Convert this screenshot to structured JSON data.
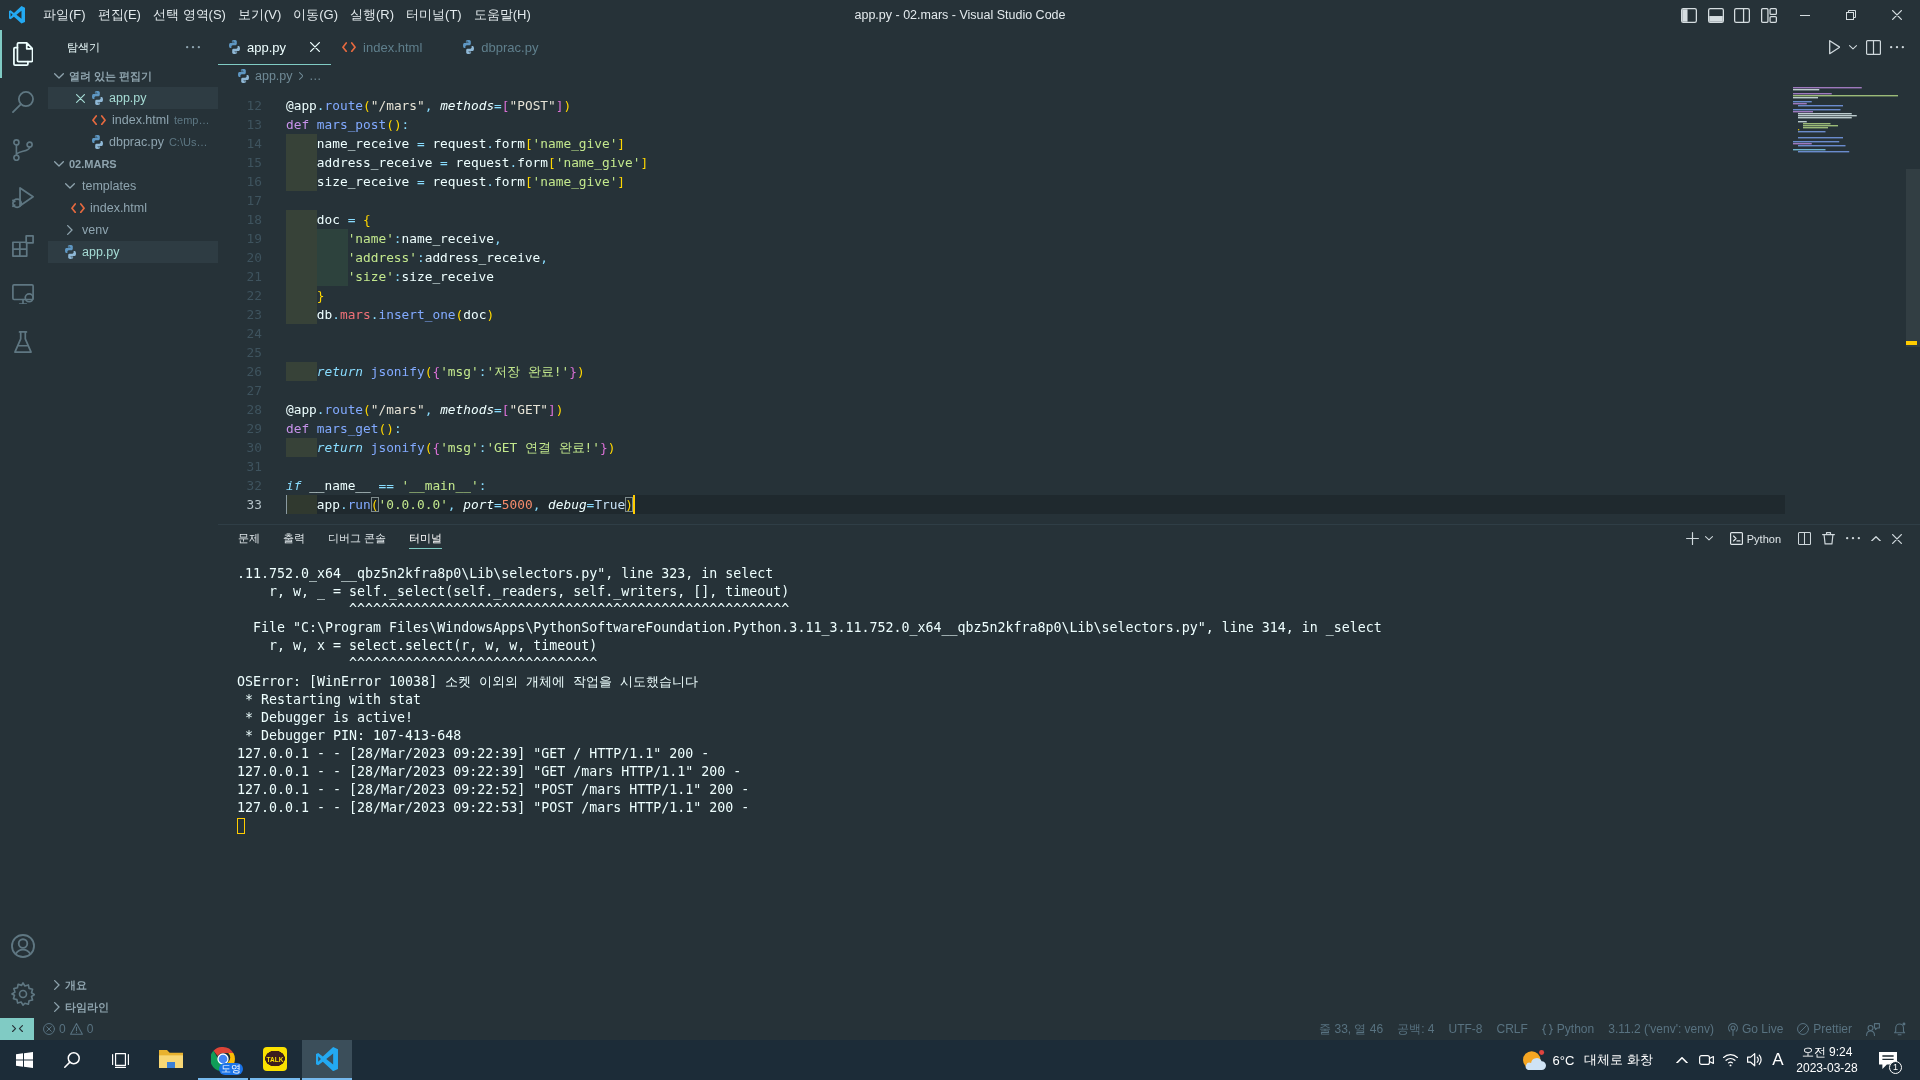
{
  "title_bar": {
    "menus": [
      "파일(F)",
      "편집(E)",
      "선택 영역(S)",
      "보기(V)",
      "이동(G)",
      "실행(R)",
      "터미널(T)",
      "도움말(H)"
    ],
    "title": "app.py - 02.mars - Visual Studio Code",
    "layout_toggles": [
      {
        "kind": "sidebar",
        "on": true
      },
      {
        "kind": "panel",
        "on": true
      },
      {
        "kind": "secondary",
        "on": false
      }
    ]
  },
  "activity_bar": {
    "items": [
      {
        "kind": "explorer",
        "selected": true
      },
      {
        "kind": "search",
        "selected": false
      },
      {
        "kind": "source_control",
        "selected": false
      },
      {
        "kind": "run_debug",
        "selected": false
      },
      {
        "kind": "extensions",
        "selected": false
      },
      {
        "kind": "remote",
        "selected": false
      },
      {
        "kind": "testing",
        "selected": false
      }
    ],
    "bottom": [
      {
        "kind": "account"
      },
      {
        "kind": "settings"
      }
    ]
  },
  "sidebar": {
    "title": "탐색기",
    "open_editors": {
      "label": "열려 있는 편집기",
      "expanded": true,
      "items": [
        {
          "kind": "python",
          "name": "app.py",
          "selected": true
        },
        {
          "kind": "html",
          "name": "index.html",
          "description": "temp…",
          "selected": false
        },
        {
          "kind": "python",
          "name": "dbprac.py",
          "description": "C:\\Us…",
          "selected": false
        }
      ]
    },
    "folder": {
      "label": "02.MARS",
      "expanded": true,
      "tree": [
        {
          "kind": "folder",
          "name": "templates",
          "expanded": true,
          "selected": false,
          "children": [
            {
              "kind": "html",
              "name": "index.html",
              "selected": false
            }
          ]
        },
        {
          "kind": "folder",
          "name": "venv",
          "expanded": false,
          "selected": false
        },
        {
          "kind": "python",
          "name": "app.py",
          "selected": true
        }
      ]
    },
    "bottom_sections": [
      {
        "label": "개요",
        "expanded": false
      },
      {
        "label": "타임라인",
        "expanded": false
      }
    ]
  },
  "editor": {
    "tabs": [
      {
        "kind": "python",
        "label": "app.py",
        "selected": true
      },
      {
        "kind": "html",
        "label": "index.html",
        "selected": false
      },
      {
        "kind": "python",
        "label": "dbprac.py",
        "selected": false
      }
    ],
    "breadcrumbs": [
      {
        "kind": "python",
        "label": "app.py"
      },
      {
        "kind": "symbol",
        "label": "…"
      }
    ],
    "lines": [
      {
        "number": "12",
        "current": false,
        "tokens": [
          {
            "text": "@app",
            "kind": "plain"
          },
          {
            "text": ".",
            "kind": "punct"
          },
          {
            "text": "route",
            "kind": "func"
          },
          {
            "text": "(",
            "kind": "bracket1"
          },
          {
            "text": "\"/mars\"",
            "kind": "dstring"
          },
          {
            "text": ", ",
            "kind": "punct"
          },
          {
            "text": "methods",
            "kind": "param"
          },
          {
            "text": "=",
            "kind": "punct"
          },
          {
            "text": "[",
            "kind": "bracket2"
          },
          {
            "text": "\"POST\"",
            "kind": "dstring"
          },
          {
            "text": "]",
            "kind": "bracket2"
          },
          {
            "text": ")",
            "kind": "bracket1"
          }
        ]
      },
      {
        "number": "13",
        "current": false,
        "tokens": [
          {
            "text": "def ",
            "kind": "keyword"
          },
          {
            "text": "mars_post",
            "kind": "func"
          },
          {
            "text": "()",
            "kind": "bracket1"
          },
          {
            "text": ":",
            "kind": "punct"
          }
        ],
        "children": [
          {
            "number": "14",
            "current": false,
            "tokens": [
              {
                "text": "name_receive ",
                "kind": "plain"
              },
              {
                "text": "=",
                "kind": "punct"
              },
              {
                "text": " request",
                "kind": "plain"
              },
              {
                "text": ".",
                "kind": "punct"
              },
              {
                "text": "form",
                "kind": "plain"
              },
              {
                "text": "[",
                "kind": "bracket1"
              },
              {
                "text": "'name_give'",
                "kind": "string"
              },
              {
                "text": "]",
                "kind": "bracket1"
              }
            ]
          },
          {
            "number": "15",
            "current": false,
            "tokens": [
              {
                "text": "address_receive ",
                "kind": "plain"
              },
              {
                "text": "=",
                "kind": "punct"
              },
              {
                "text": " request",
                "kind": "plain"
              },
              {
                "text": ".",
                "kind": "punct"
              },
              {
                "text": "form",
                "kind": "plain"
              },
              {
                "text": "[",
                "kind": "bracket1"
              },
              {
                "text": "'name_give'",
                "kind": "string"
              },
              {
                "text": "]",
                "kind": "bracket1"
              }
            ]
          },
          {
            "number": "16",
            "current": false,
            "tokens": [
              {
                "text": "size_receive ",
                "kind": "plain"
              },
              {
                "text": "=",
                "kind": "punct"
              },
              {
                "text": " request",
                "kind": "plain"
              },
              {
                "text": ".",
                "kind": "punct"
              },
              {
                "text": "form",
                "kind": "plain"
              },
              {
                "text": "[",
                "kind": "bracket1"
              },
              {
                "text": "'name_give'",
                "kind": "string"
              },
              {
                "text": "]",
                "kind": "bracket1"
              }
            ]
          },
          {
            "number": "17",
            "current": false
          },
          {
            "number": "18",
            "current": false,
            "tokens": [
              {
                "text": "doc ",
                "kind": "plain"
              },
              {
                "text": "=",
                "kind": "punct"
              },
              {
                "text": " {",
                "kind": "bracket1"
              }
            ],
            "children": [
              {
                "number": "19",
                "current": false,
                "tokens": [
                  {
                    "text": "'name'",
                    "kind": "string"
                  },
                  {
                    "text": ":",
                    "kind": "punct"
                  },
                  {
                    "text": "name_receive",
                    "kind": "plain"
                  },
                  {
                    "text": ",",
                    "kind": "punct"
                  }
                ]
              },
              {
                "number": "20",
                "current": false,
                "tokens": [
                  {
                    "text": "'address'",
                    "kind": "string"
                  },
                  {
                    "text": ":",
                    "kind": "punct"
                  },
                  {
                    "text": "address_receive",
                    "kind": "plain"
                  },
                  {
                    "text": ",",
                    "kind": "punct"
                  }
                ]
              },
              {
                "number": "21",
                "current": false,
                "tokens": [
                  {
                    "text": "'size'",
                    "kind": "string"
                  },
                  {
                    "text": ":",
                    "kind": "punct"
                  },
                  {
                    "text": "size_receive",
                    "kind": "plain"
                  }
                ]
              }
            ]
          },
          {
            "number": "22",
            "current": false,
            "tokens": [
              {
                "text": "}",
                "kind": "bracket1"
              }
            ]
          },
          {
            "number": "23",
            "current": false,
            "tokens": [
              {
                "text": "db",
                "kind": "plain"
              },
              {
                "text": ".",
                "kind": "punct"
              },
              {
                "text": "mars",
                "kind": "prop"
              },
              {
                "text": ".",
                "kind": "punct"
              },
              {
                "text": "insert_one",
                "kind": "func"
              },
              {
                "text": "(",
                "kind": "bracket1"
              },
              {
                "text": "doc",
                "kind": "plain"
              },
              {
                "text": ")",
                "kind": "bracket1"
              }
            ]
          },
          {
            "number": "24",
            "current": false
          },
          {
            "number": "25",
            "current": false
          },
          {
            "number": "26",
            "current": false,
            "tokens": [
              {
                "text": "return ",
                "kind": "control"
              },
              {
                "text": "jsonify",
                "kind": "func"
              },
              {
                "text": "(",
                "kind": "bracket1"
              },
              {
                "text": "{",
                "kind": "bracket2"
              },
              {
                "text": "'msg'",
                "kind": "string"
              },
              {
                "text": ":",
                "kind": "punct"
              },
              {
                "text": "'저장 완료!'",
                "kind": "string"
              },
              {
                "text": "}",
                "kind": "bracket2"
              },
              {
                "text": ")",
                "kind": "bracket1"
              }
            ]
          }
        ]
      },
      {
        "number": "27",
        "current": false
      },
      {
        "number": "28",
        "current": false,
        "tokens": [
          {
            "text": "@app",
            "kind": "plain"
          },
          {
            "text": ".",
            "kind": "punct"
          },
          {
            "text": "route",
            "kind": "func"
          },
          {
            "text": "(",
            "kind": "bracket1"
          },
          {
            "text": "\"/mars\"",
            "kind": "dstring"
          },
          {
            "text": ", ",
            "kind": "punct"
          },
          {
            "text": "methods",
            "kind": "param"
          },
          {
            "text": "=",
            "kind": "punct"
          },
          {
            "text": "[",
            "kind": "bracket2"
          },
          {
            "text": "\"GET\"",
            "kind": "dstring"
          },
          {
            "text": "]",
            "kind": "bracket2"
          },
          {
            "text": ")",
            "kind": "bracket1"
          }
        ]
      },
      {
        "number": "29",
        "current": false,
        "tokens": [
          {
            "text": "def ",
            "kind": "keyword"
          },
          {
            "text": "mars_get",
            "kind": "func"
          },
          {
            "text": "()",
            "kind": "bracket1"
          },
          {
            "text": ":",
            "kind": "punct"
          }
        ],
        "children": [
          {
            "number": "30",
            "current": false,
            "tokens": [
              {
                "text": "return ",
                "kind": "control"
              },
              {
                "text": "jsonify",
                "kind": "func"
              },
              {
                "text": "(",
                "kind": "bracket1"
              },
              {
                "text": "{",
                "kind": "bracket2"
              },
              {
                "text": "'msg'",
                "kind": "string"
              },
              {
                "text": ":",
                "kind": "punct"
              },
              {
                "text": "'GET 연결 완료!'",
                "kind": "string"
              },
              {
                "text": "}",
                "kind": "bracket2"
              },
              {
                "text": ")",
                "kind": "bracket1"
              }
            ]
          }
        ]
      },
      {
        "number": "31",
        "current": false
      },
      {
        "number": "32",
        "current": false,
        "tokens": [
          {
            "text": "if",
            "kind": "control"
          },
          {
            "text": " __name__ ",
            "kind": "plain"
          },
          {
            "text": "== ",
            "kind": "punct"
          },
          {
            "text": "'__main__'",
            "kind": "string"
          },
          {
            "text": ":",
            "kind": "punct"
          }
        ],
        "children": [
          {
            "number": "33",
            "current": true,
            "tokens": [
              {
                "text": "app",
                "kind": "plain"
              },
              {
                "text": ".",
                "kind": "punct"
              },
              {
                "text": "run",
                "kind": "func"
              },
              {
                "text": "(",
                "kind": "matched"
              },
              {
                "text": "'0.0.0.0'",
                "kind": "string"
              },
              {
                "text": ", ",
                "kind": "punct"
              },
              {
                "text": "port",
                "kind": "param"
              },
              {
                "text": "=",
                "kind": "punct"
              },
              {
                "text": "5000",
                "kind": "number"
              },
              {
                "text": ", ",
                "kind": "punct"
              },
              {
                "text": "debug",
                "kind": "param"
              },
              {
                "text": "=",
                "kind": "punct"
              },
              {
                "text": "True",
                "kind": "const"
              },
              {
                "text": ")",
                "kind": "matched"
              }
            ]
          }
        ]
      }
    ]
  },
  "panel": {
    "tabs": [
      {
        "label": "문제",
        "selected": false
      },
      {
        "label": "출력",
        "selected": false
      },
      {
        "label": "디버그 콘솔",
        "selected": false
      },
      {
        "label": "터미널",
        "selected": true
      }
    ],
    "terminal_profile": "Python",
    "terminal_lines": [
      ".11.752.0_x64__qbz5n2kfra8p0\\Lib\\selectors.py\", line 323, in select",
      "    r, w, _ = self._select(self._readers, self._writers, [], timeout)",
      "              ^^^^^^^^^^^^^^^^^^^^^^^^^^^^^^^^^^^^^^^^^^^^^^^^^^^^^^^",
      "  File \"C:\\Program Files\\WindowsApps\\PythonSoftwareFoundation.Python.3.11_3.11.752.0_x64__qbz5n2kfra8p0\\Lib\\selectors.py\", line 314, in _select",
      "    r, w, x = select.select(r, w, w, timeout)",
      "              ^^^^^^^^^^^^^^^^^^^^^^^^^^^^^^^",
      "OSError: [WinError 10038] 소켓 이외의 개체에 작업을 시도했습니다",
      " * Restarting with stat",
      " * Debugger is active!",
      " * Debugger PIN: 107-413-648",
      "127.0.0.1 - - [28/Mar/2023 09:22:39] \"GET / HTTP/1.1\" 200 -",
      "127.0.0.1 - - [28/Mar/2023 09:22:39] \"GET /mars HTTP/1.1\" 200 -",
      "127.0.0.1 - - [28/Mar/2023 09:22:52] \"POST /mars HTTP/1.1\" 200 -",
      "127.0.0.1 - - [28/Mar/2023 09:22:53] \"POST /mars HTTP/1.1\" 200 -"
    ]
  },
  "status_bar": {
    "errors": "0",
    "warnings": "0",
    "items": [
      {
        "kind": "plain",
        "text": "줄 33, 열 46"
      },
      {
        "kind": "plain",
        "text": "공백: 4"
      },
      {
        "kind": "plain",
        "text": "UTF-8"
      },
      {
        "kind": "plain",
        "text": "CRLF"
      },
      {
        "kind": "language",
        "text": "Python"
      },
      {
        "kind": "plain",
        "text": "3.11.2 ('venv': venv)"
      },
      {
        "kind": "server",
        "text": "Go Live"
      },
      {
        "kind": "formatter",
        "text": "Prettier"
      }
    ]
  },
  "taskbar": {
    "apps": [
      {
        "kind": "file_explorer",
        "running": false,
        "active": false
      },
      {
        "kind": "browser",
        "running": true,
        "active": false,
        "badge": "도영"
      },
      {
        "kind": "chat",
        "running": true,
        "active": false,
        "logo_text": "TALK"
      },
      {
        "kind": "code_editor",
        "running": true,
        "active": true
      }
    ],
    "weather": {
      "temperature": "6°C",
      "condition": "대체로 화창"
    },
    "input_indicator": "A",
    "clock": {
      "time": "오전 9:24",
      "date": "2023-03-28"
    },
    "notification_count": "1"
  }
}
